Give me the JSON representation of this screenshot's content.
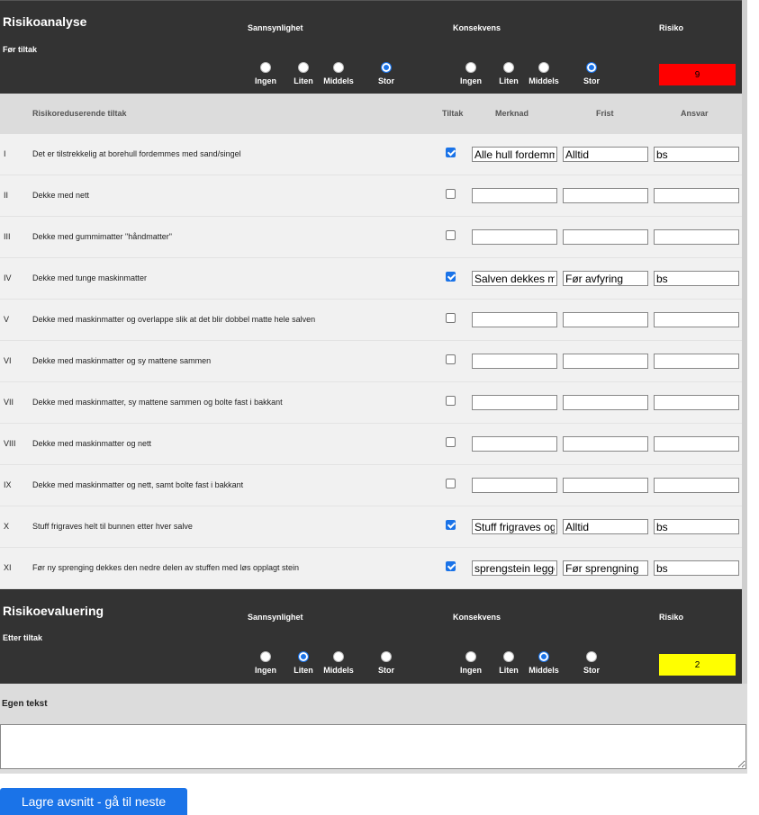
{
  "before": {
    "title": "Risikoanalyse",
    "subtitle": "Før tiltak",
    "prob_label": "Sannsynlighet",
    "cons_label": "Konsekvens",
    "risk_label": "Risiko",
    "options": [
      "Ingen",
      "Liten",
      "Middels",
      "Stor"
    ],
    "prob_selected": "Stor",
    "cons_selected": "Stor",
    "risk_value": "9",
    "risk_color": "#ff0000"
  },
  "table": {
    "headers": {
      "measure": "Risikoreduserende tiltak",
      "tiltak": "Tiltak",
      "merknad": "Merknad",
      "frist": "Frist",
      "ansvar": "Ansvar"
    },
    "rows": [
      {
        "num": "I",
        "text": "Det er tilstrekkelig at borehull fordemmes med sand/singel",
        "checked": true,
        "merknad": "Alle hull fordemmes",
        "frist": "Alltid",
        "ansvar": "bs"
      },
      {
        "num": "II",
        "text": "Dekke med nett",
        "checked": false,
        "merknad": "",
        "frist": "",
        "ansvar": ""
      },
      {
        "num": "III",
        "text": "Dekke med gummimatter \"håndmatter\"",
        "checked": false,
        "merknad": "",
        "frist": "",
        "ansvar": ""
      },
      {
        "num": "IV",
        "text": "Dekke med tunge maskinmatter",
        "checked": true,
        "merknad": "Salven dekkes med",
        "frist": "Før avfyring",
        "ansvar": "bs"
      },
      {
        "num": "V",
        "text": "Dekke med maskinmatter og overlappe slik at det blir dobbel matte hele salven",
        "checked": false,
        "merknad": "",
        "frist": "",
        "ansvar": ""
      },
      {
        "num": "VI",
        "text": "Dekke med maskinmatter og sy mattene sammen",
        "checked": false,
        "merknad": "",
        "frist": "",
        "ansvar": ""
      },
      {
        "num": "VII",
        "text": "Dekke med maskinmatter, sy mattene sammen og bolte fast i bakkant",
        "checked": false,
        "merknad": "",
        "frist": "",
        "ansvar": ""
      },
      {
        "num": "VIII",
        "text": "Dekke med maskinmatter og nett",
        "checked": false,
        "merknad": "",
        "frist": "",
        "ansvar": ""
      },
      {
        "num": "IX",
        "text": "Dekke med maskinmatter og nett, samt bolte fast i bakkant",
        "checked": false,
        "merknad": "",
        "frist": "",
        "ansvar": ""
      },
      {
        "num": "X",
        "text": "Stuff frigraves helt til bunnen etter hver salve",
        "checked": true,
        "merknad": "Stuff frigraves og",
        "frist": "Alltid",
        "ansvar": "bs"
      },
      {
        "num": "XI",
        "text": "Før ny sprenging dekkes den nedre delen av stuffen med løs opplagt stein",
        "checked": true,
        "merknad": "sprengstein legges",
        "frist": "Før sprengning",
        "ansvar": "bs"
      }
    ]
  },
  "after": {
    "title": "Risikoevaluering",
    "subtitle": "Etter tiltak",
    "prob_label": "Sannsynlighet",
    "cons_label": "Konsekvens",
    "risk_label": "Risiko",
    "options": [
      "Ingen",
      "Liten",
      "Middels",
      "Stor"
    ],
    "prob_selected": "Liten",
    "cons_selected": "Middels",
    "risk_value": "2",
    "risk_color": "#ffff00"
  },
  "egen": {
    "label": "Egen tekst",
    "value": ""
  },
  "save_label": "Lagre avsnitt - gå til neste"
}
